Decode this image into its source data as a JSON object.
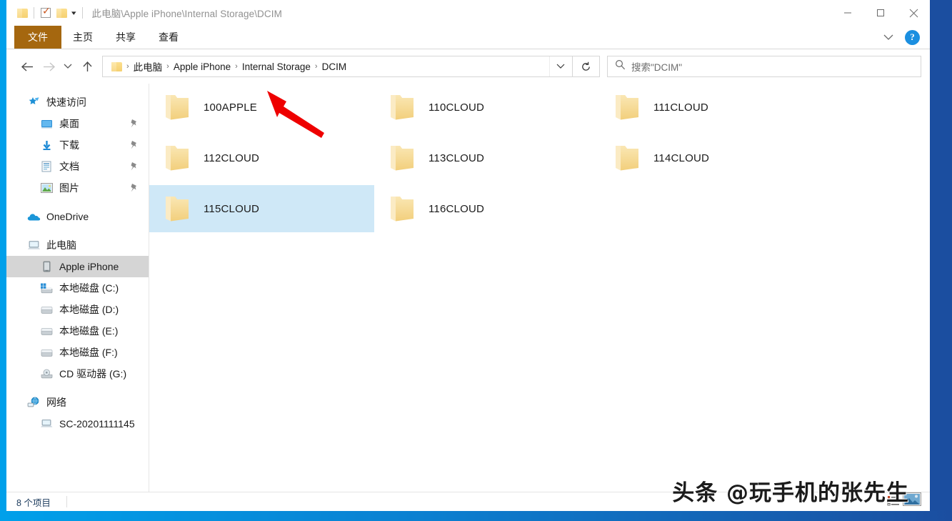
{
  "window": {
    "title_path": "此电脑\\Apple iPhone\\Internal Storage\\DCIM",
    "minimize_label": "最小化",
    "maximize_label": "最大化",
    "close_label": "关闭"
  },
  "quick_access_toolbar": {
    "folder_icon": "folder-icon",
    "properties_icon": "checkbox-check-icon",
    "new_folder_icon": "folder-icon",
    "customize_caret": "caret-down-icon"
  },
  "ribbon": {
    "tabs": [
      {
        "label": "文件",
        "active": true
      },
      {
        "label": "主页",
        "active": false
      },
      {
        "label": "共享",
        "active": false
      },
      {
        "label": "查看",
        "active": false
      }
    ],
    "expand_icon": "chevron-down-icon",
    "help_label": "?",
    "file_tab_color": "#a5670f"
  },
  "nav": {
    "back_icon": "arrow-left-icon",
    "forward_icon": "arrow-right-icon",
    "recent_icon": "chevron-down-icon",
    "up_icon": "arrow-up-icon",
    "address_folder_icon": "folder-icon",
    "breadcrumbs": [
      "此电脑",
      "Apple iPhone",
      "Internal Storage",
      "DCIM"
    ],
    "breadcrumb_separator": "›",
    "address_caret_icon": "chevron-down-icon",
    "refresh_icon": "refresh-icon"
  },
  "search": {
    "icon": "search-icon",
    "placeholder": "搜索\"DCIM\"",
    "value": ""
  },
  "sidebar": {
    "items": [
      {
        "label": "快速访问",
        "icon": "star-pin-icon",
        "level": 0,
        "pinned": false,
        "selected": false
      },
      {
        "label": "桌面",
        "icon": "desktop-icon",
        "level": 1,
        "pinned": true,
        "selected": false
      },
      {
        "label": "下载",
        "icon": "download-icon",
        "level": 1,
        "pinned": true,
        "selected": false
      },
      {
        "label": "文档",
        "icon": "document-icon",
        "level": 1,
        "pinned": true,
        "selected": false
      },
      {
        "label": "图片",
        "icon": "pictures-icon",
        "level": 1,
        "pinned": true,
        "selected": false
      },
      {
        "label": "OneDrive",
        "icon": "onedrive-cloud-icon",
        "level": 0,
        "pinned": false,
        "selected": false
      },
      {
        "label": "此电脑",
        "icon": "this-pc-icon",
        "level": 0,
        "pinned": false,
        "selected": false
      },
      {
        "label": "Apple iPhone",
        "icon": "phone-device-icon",
        "level": 1,
        "pinned": false,
        "selected": true
      },
      {
        "label": "本地磁盘 (C:)",
        "icon": "windows-drive-icon",
        "level": 1,
        "pinned": false,
        "selected": false
      },
      {
        "label": "本地磁盘 (D:)",
        "icon": "drive-icon",
        "level": 1,
        "pinned": false,
        "selected": false
      },
      {
        "label": "本地磁盘 (E:)",
        "icon": "drive-icon",
        "level": 1,
        "pinned": false,
        "selected": false
      },
      {
        "label": "本地磁盘 (F:)",
        "icon": "drive-icon",
        "level": 1,
        "pinned": false,
        "selected": false
      },
      {
        "label": "CD 驱动器 (G:)",
        "icon": "cd-drive-icon",
        "level": 1,
        "pinned": false,
        "selected": false
      },
      {
        "label": "网络",
        "icon": "network-icon",
        "level": 0,
        "pinned": false,
        "selected": false
      },
      {
        "label": "SC-20201111145 ",
        "icon": "computer-icon",
        "level": 1,
        "pinned": false,
        "selected": false
      }
    ]
  },
  "content": {
    "folders": [
      {
        "name": "100APPLE",
        "selected": false
      },
      {
        "name": "110CLOUD",
        "selected": false
      },
      {
        "name": "111CLOUD",
        "selected": false
      },
      {
        "name": "112CLOUD",
        "selected": false
      },
      {
        "name": "113CLOUD",
        "selected": false
      },
      {
        "name": "114CLOUD",
        "selected": false
      },
      {
        "name": "115CLOUD",
        "selected": true
      },
      {
        "name": "116CLOUD",
        "selected": false
      }
    ],
    "selection_color": "#cfe8f7",
    "annotation": {
      "type": "red-arrow",
      "color": "#ee0000",
      "points_to": "100APPLE"
    }
  },
  "statusbar": {
    "item_count_text": "8 个项目",
    "view_details_icon": "details-view-icon",
    "view_large_icon": "large-icons-view-icon"
  },
  "watermark": {
    "text": "头条 @玩手机的张先生"
  },
  "colors": {
    "desktop_left": "#00a0ea",
    "desktop_right": "#1b4ea0",
    "ribbon_file_tab": "#a5670f",
    "sidebar_selected": "#d5d5d5",
    "tile_selected": "#cfe8f7",
    "folder_yellow": "#f6d88c"
  }
}
